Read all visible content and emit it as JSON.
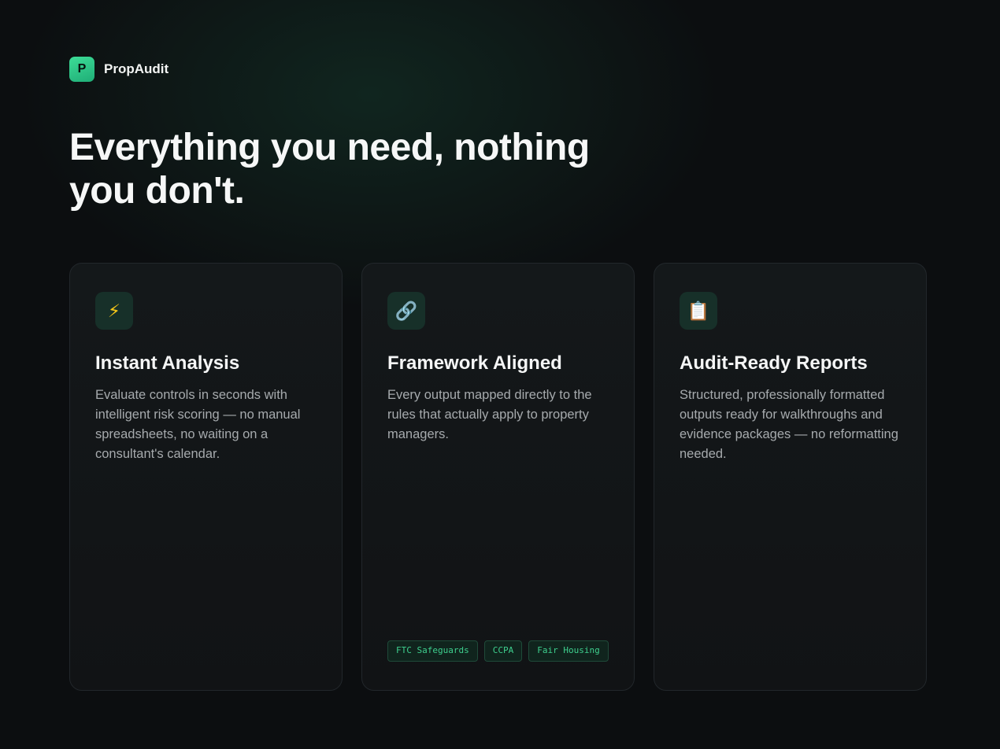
{
  "brand": {
    "logo_letter": "P",
    "name": "PropAudit"
  },
  "headline": "Everything you need, nothing you don't.",
  "colors": {
    "background": "#0c0e10",
    "accent": "#3ecf8e",
    "card_border": "#22272b",
    "text_muted": "#a6aaad"
  },
  "cards": [
    {
      "icon": "lightning-icon",
      "icon_glyph": "⚡",
      "title": "Instant Analysis",
      "description": "Evaluate controls in seconds with intelligent risk scoring — no manual spreadsheets, no waiting on a consultant's calendar."
    },
    {
      "icon": "link-icon",
      "icon_glyph": "🔗",
      "title": "Framework Aligned",
      "description": "Every output mapped directly to the rules that actually apply to property managers.",
      "tags": [
        "FTC Safeguards",
        "CCPA",
        "Fair Housing"
      ]
    },
    {
      "icon": "clipboard-icon",
      "icon_glyph": "📋",
      "title": "Audit-Ready Reports",
      "description": "Structured, professionally formatted outputs ready for walkthroughs and evidence packages — no reformatting needed."
    }
  ]
}
